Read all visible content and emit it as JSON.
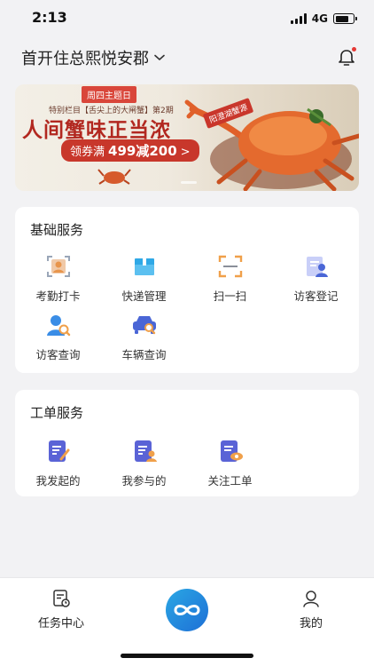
{
  "status": {
    "time": "2:13",
    "network": "4G"
  },
  "header": {
    "community": "首开住总熙悦安郡"
  },
  "banner": {
    "tag": "周四主题日",
    "subtitle": "特别栏目【舌尖上的大闸蟹】第2期",
    "title": "人间蟹味正当浓",
    "coupon_prefix": "领券满",
    "coupon_amount": "499减200",
    "coupon_arrow": ">",
    "stamp": "阳澄湖蟹源"
  },
  "basic_services": {
    "title": "基础服务",
    "items": [
      {
        "label": "考勤打卡",
        "icon": "attendance-icon"
      },
      {
        "label": "快递管理",
        "icon": "package-icon"
      },
      {
        "label": "扫一扫",
        "icon": "scan-icon"
      },
      {
        "label": "访客登记",
        "icon": "visitor-register-icon"
      },
      {
        "label": "访客查询",
        "icon": "visitor-search-icon"
      },
      {
        "label": "车辆查询",
        "icon": "car-search-icon"
      }
    ]
  },
  "work_orders": {
    "title": "工单服务",
    "items": [
      {
        "label": "我发起的",
        "icon": "order-edit-icon"
      },
      {
        "label": "我参与的",
        "icon": "order-participate-icon"
      },
      {
        "label": "关注工单",
        "icon": "order-watch-icon"
      }
    ]
  },
  "tabbar": {
    "tasks": "任务中心",
    "center_icon": "infinity-icon",
    "mine": "我的"
  },
  "colors": {
    "accent": "#4a66d6",
    "brand_blue": "#1e8fe0",
    "notify": "#e53935"
  }
}
